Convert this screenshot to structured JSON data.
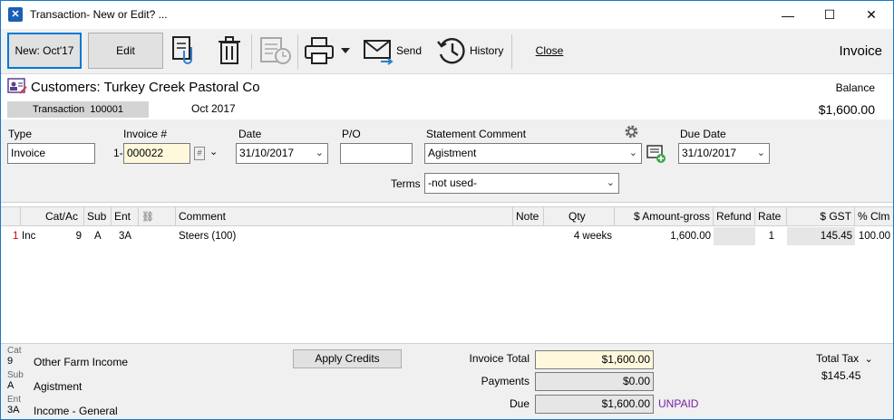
{
  "window": {
    "title": "Transaction- New or Edit? ...",
    "minimize": "—",
    "maximize": "☐",
    "close": "✕"
  },
  "toolbar": {
    "new_label": "New: Oct'17",
    "edit_label": "Edit",
    "send_label": "Send",
    "history_label": "History",
    "close_label": "Close",
    "mode_label": "Invoice"
  },
  "header": {
    "customer": "Customers: Turkey Creek Pastoral Co",
    "balance_label": "Balance",
    "balance_value": "$1,600.00",
    "transaction_label": "Transaction",
    "transaction_number": "100001",
    "period": "Oct 2017"
  },
  "form": {
    "type_label": "Type",
    "type_value": "Invoice",
    "invoice_label": "Invoice #",
    "invoice_prefix": "1-",
    "invoice_value": "000022",
    "date_label": "Date",
    "date_value": "31/10/2017",
    "po_label": "P/O",
    "po_value": "",
    "statement_label": "Statement Comment",
    "statement_value": "Agistment",
    "due_label": "Due Date",
    "due_value": "31/10/2017",
    "terms_label": "Terms",
    "terms_value": "-not used-"
  },
  "grid": {
    "columns": [
      "Cat/Ac",
      "Sub",
      "Ent",
      "Comment",
      "Note",
      "Qty",
      "$ Amount-gross",
      "Refund",
      "Rate",
      "$ GST",
      "% Clm"
    ],
    "rows": [
      {
        "num": "1",
        "kind": "Inc",
        "cat": "9",
        "sub": "A",
        "ent": "3A",
        "comment": "Steers (100)",
        "note": "",
        "qty": "4 weeks",
        "amount": "1,600.00",
        "refund": "",
        "rate": "1",
        "gst": "145.45",
        "clm": "100.00"
      }
    ]
  },
  "footer": {
    "cat_tag": "Cat",
    "cat_val": "9",
    "cat_desc": "Other Farm Income",
    "sub_tag": "Sub",
    "sub_val": "A",
    "sub_desc": "Agistment",
    "ent_tag": "Ent",
    "ent_val": "3A",
    "ent_desc": "Income - General",
    "apply_credits": "Apply Credits",
    "invoice_total_label": "Invoice Total",
    "invoice_total": "$1,600.00",
    "payments_label": "Payments",
    "payments": "$0.00",
    "due_label": "Due",
    "due": "$1,600.00",
    "status": "UNPAID",
    "total_tax_label": "Total Tax",
    "total_tax": "$145.45"
  },
  "colors": {
    "accent": "#0078d7",
    "unpaid": "#7a1fa2",
    "invoice_field": "#fff8dc"
  }
}
